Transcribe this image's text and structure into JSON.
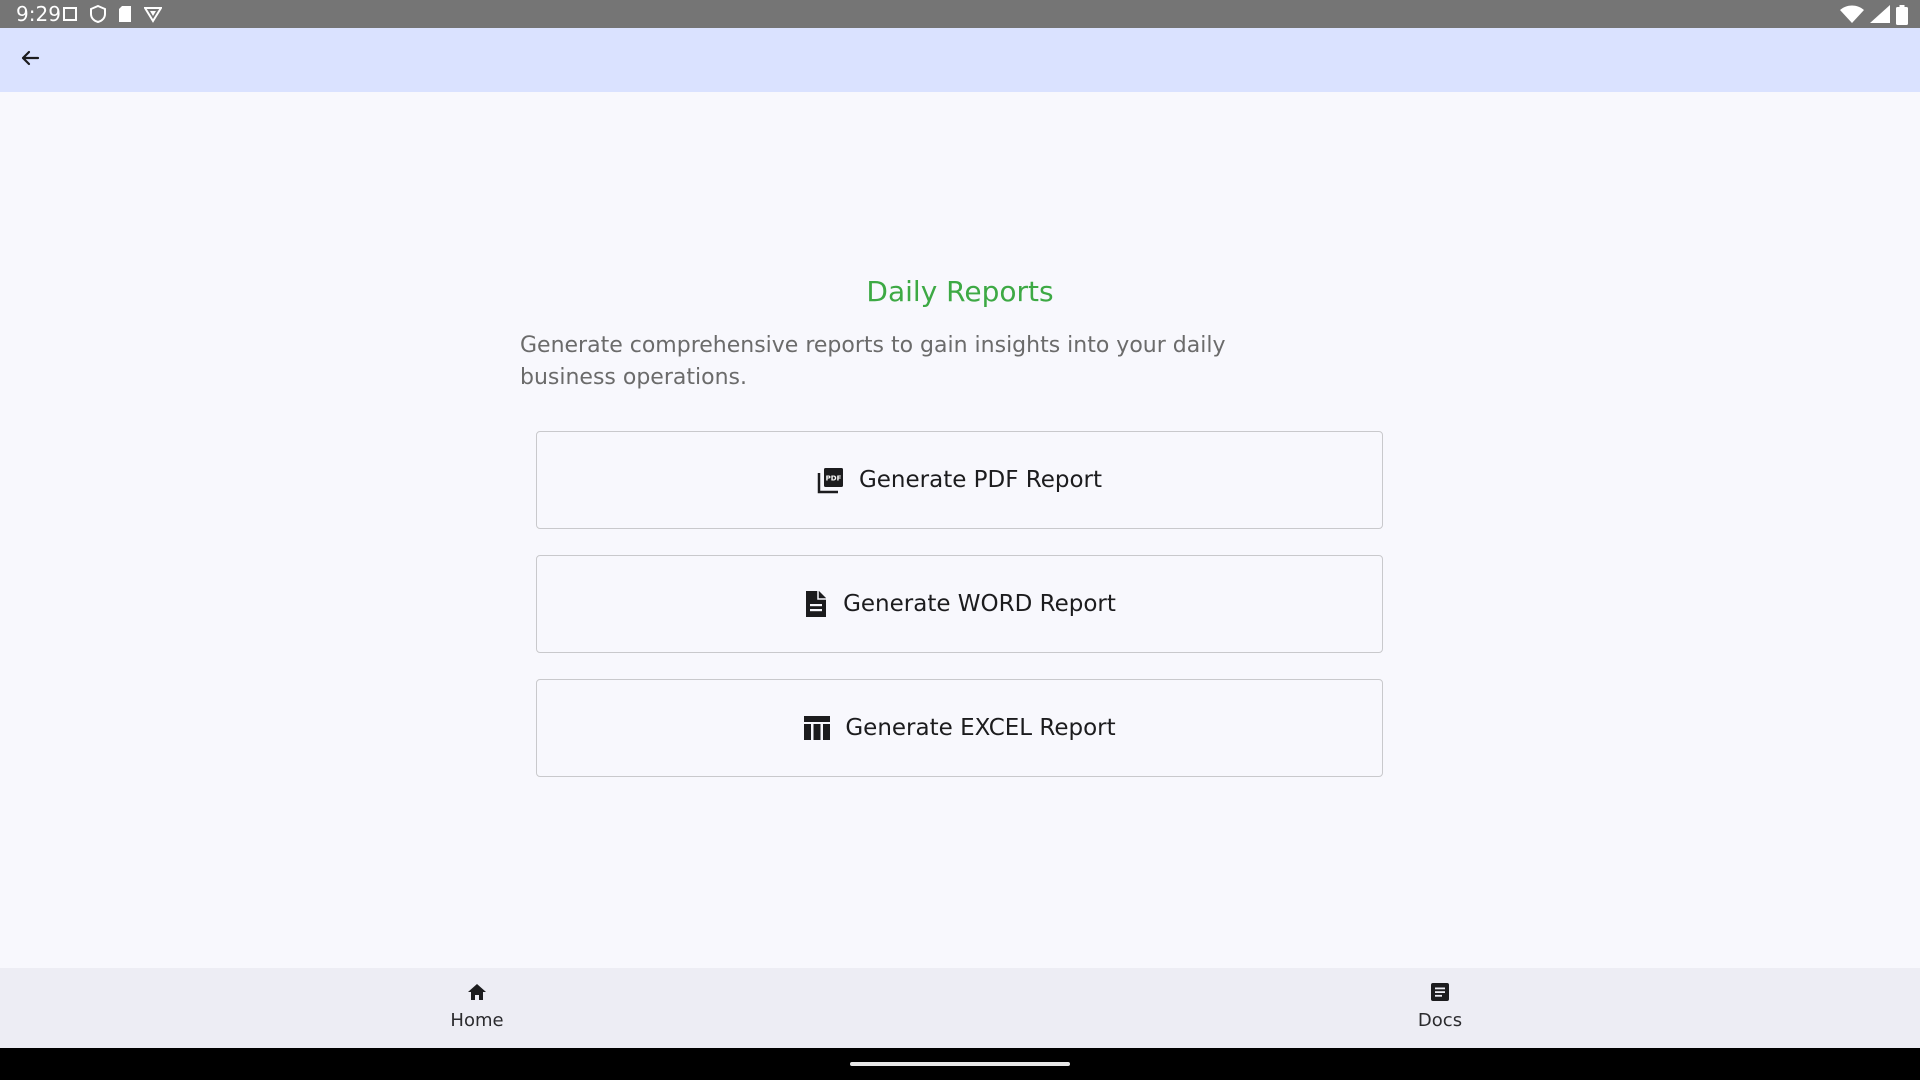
{
  "status_bar": {
    "time": "9:29",
    "left_icons": [
      "screen-icon",
      "shield-icon",
      "sd-card-icon",
      "vpn-badge-icon"
    ],
    "right_icons": [
      "wifi-icon",
      "signal-icon",
      "battery-icon"
    ]
  },
  "app_bar": {
    "back_icon": "arrow-left-icon",
    "background": "#dae2ff"
  },
  "main": {
    "title": "Daily Reports",
    "title_color": "#3da944",
    "description": "Generate comprehensive reports to gain insights into your daily business operations.",
    "buttons": [
      {
        "label": "Generate PDF Report",
        "icon": "pdf-icon"
      },
      {
        "label": "Generate WORD Report",
        "icon": "document-icon"
      },
      {
        "label": "Generate EXCEL Report",
        "icon": "table-icon"
      }
    ]
  },
  "bottom_nav": {
    "items": [
      {
        "label": "Home",
        "icon": "home-icon"
      },
      {
        "label": "Docs",
        "icon": "docs-icon"
      }
    ]
  }
}
